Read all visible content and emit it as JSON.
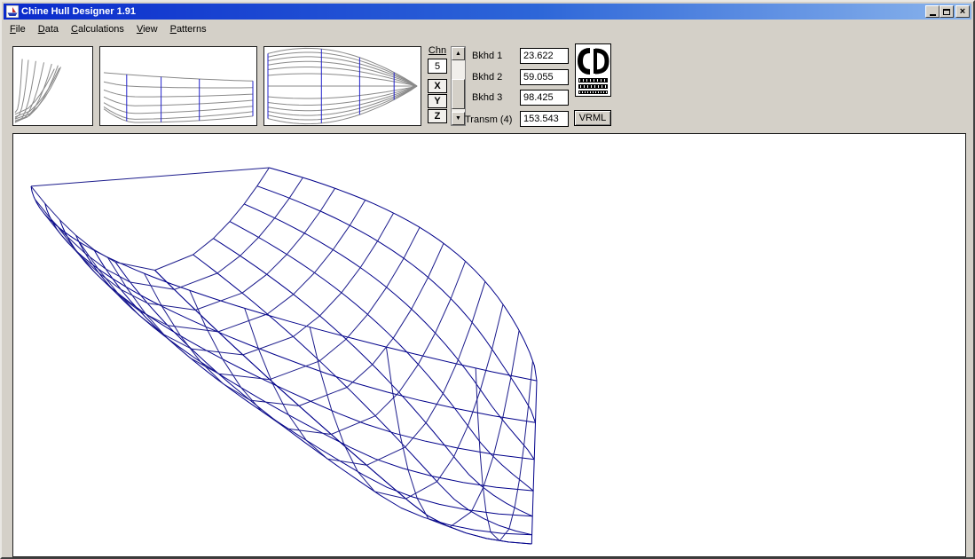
{
  "window": {
    "title": "Chine Hull Designer 1.91"
  },
  "icons": {
    "close": "×",
    "scroll_up": "▲",
    "scroll_down": "▼"
  },
  "menu": {
    "items": [
      {
        "label": "File"
      },
      {
        "label": "Data"
      },
      {
        "label": "Calculations"
      },
      {
        "label": "View"
      },
      {
        "label": "Patterns"
      }
    ]
  },
  "toolbar": {
    "chn_label": "Chn",
    "chn_value": "5",
    "axis_buttons": [
      {
        "label": "X"
      },
      {
        "label": "Y"
      },
      {
        "label": "Z"
      }
    ],
    "fields": [
      {
        "label": "Bkhd 1",
        "value": "23.622"
      },
      {
        "label": "Bkhd 2",
        "value": "59.055"
      },
      {
        "label": "Bkhd 3",
        "value": "98.425"
      },
      {
        "label": "Transm (4)",
        "value": "153.543"
      }
    ],
    "vrml_label": "VRML"
  },
  "views": {
    "hull_length": 153.543,
    "chine_count": 5,
    "colors": {
      "longitudinal": "#00008a",
      "station": "#1c1c8c",
      "ortho": "#8a8a8a",
      "bulkhead": "#2222cc"
    }
  }
}
